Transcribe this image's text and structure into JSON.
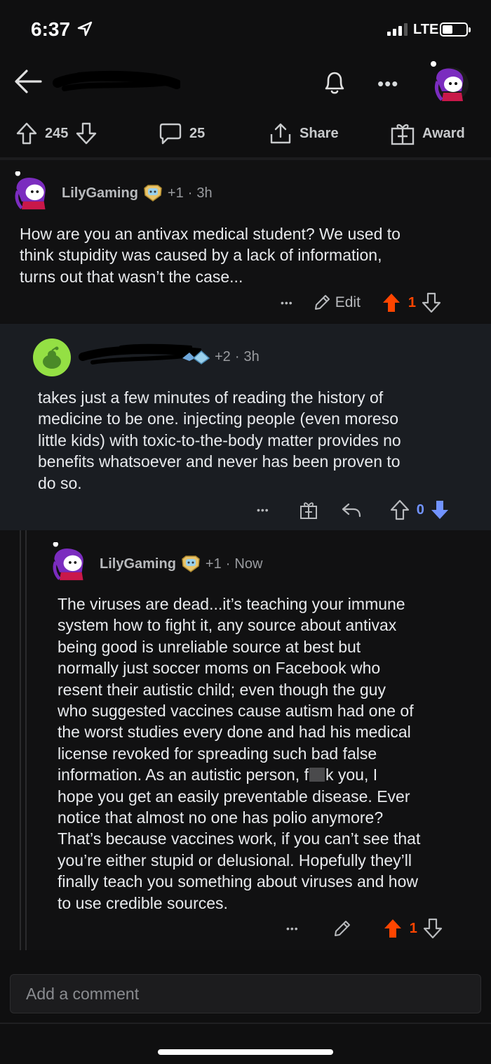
{
  "status_bar": {
    "time": "6:37",
    "network": "LTE"
  },
  "nav": {
    "back_icon": "back-arrow-icon",
    "bell_icon": "bell-icon",
    "more_label": "•••"
  },
  "post_actions": {
    "upvotes": "245",
    "comments": "25",
    "share_label": "Share",
    "award_label": "Award"
  },
  "comments": [
    {
      "username": "LilyGaming",
      "karma": "+1",
      "separator": "·",
      "time": "3h",
      "body_lines": [
        "How are you an antivax medical student?  We used to",
        "think stupidity was caused by a lack of information,",
        "turns out that wasn’t the case..."
      ],
      "more_label": "•••",
      "edit_label": "Edit",
      "score": "1"
    },
    {
      "karma": "+2",
      "separator": "·",
      "time": "3h",
      "body_lines": [
        "takes just a few minutes of reading the history of",
        "medicine to be one. injecting people (even moreso",
        "little kids) with toxic-to-the-body matter provides no",
        "benefits whatsoever and never has been proven to",
        "do so."
      ],
      "more_label": "•••",
      "score": "0"
    },
    {
      "username": "LilyGaming",
      "karma": "+1",
      "separator": "·",
      "time": "Now",
      "body_lines": [
        "The viruses are dead...it’s teaching your immune",
        "system how to fight it, any source about antivax",
        "being good is unreliable source at best but",
        "normally just soccer moms on Facebook who",
        "resent their autistic child; even though the guy",
        "who suggested vaccines cause autism had one of",
        "the worst studies every done and had his medical",
        "license revoked for spreading such bad false",
        "information.  As an autistic person, f",
        "hope you get an easily preventable disease.  Ever",
        "notice that almost no one has polio anymore?",
        "That’s because vaccines work, if you can’t see that",
        "you’re either stupid or delusional.  Hopefully they’ll",
        "finally teach you something about viruses and how",
        "to use credible sources."
      ],
      "censored_tail": "k you, I",
      "more_label": "•••",
      "score": "1"
    }
  ],
  "comment_input": {
    "placeholder": "Add a comment"
  },
  "colors": {
    "upvote": "#ff4500",
    "downvote": "#7193ff",
    "background": "#0f0f10"
  }
}
